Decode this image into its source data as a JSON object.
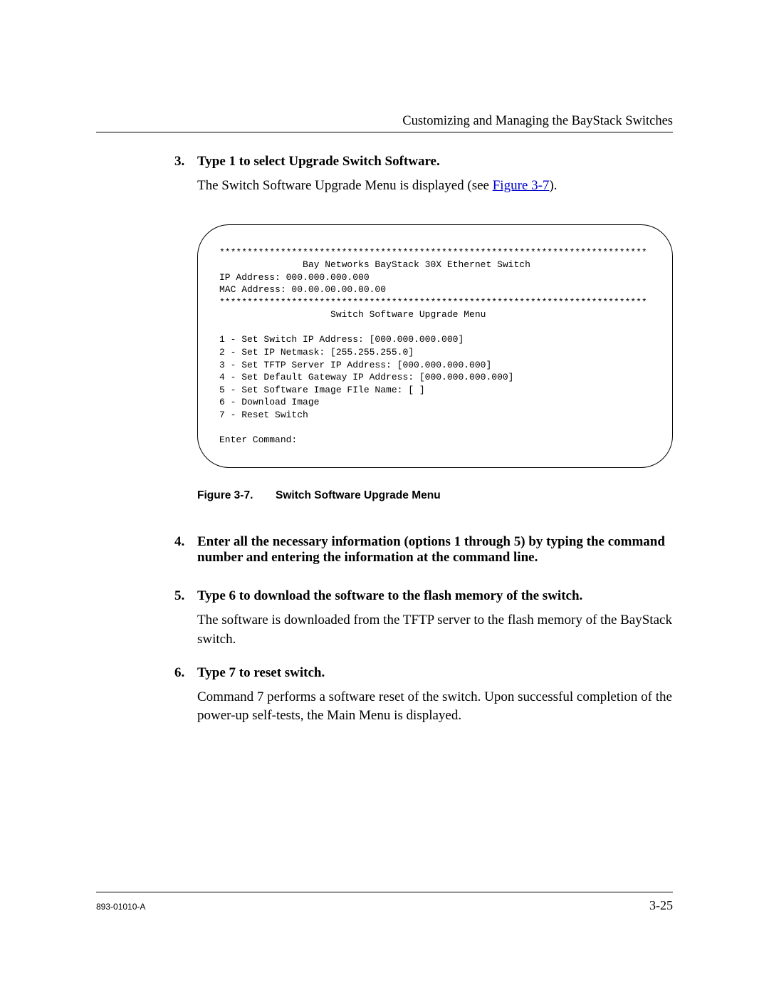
{
  "header": {
    "chapter_title": "Customizing and Managing the BayStack Switches"
  },
  "steps": [
    {
      "num": "3.",
      "title": "Type 1 to select Upgrade Switch Software.",
      "body_prefix": "The Switch Software Upgrade Menu is displayed (see ",
      "link_text": "Figure 3-7",
      "body_suffix": ")."
    },
    {
      "num": "4.",
      "title": "Enter all the necessary information (options 1 through 5) by typing the command number and entering the information at the command line."
    },
    {
      "num": "5.",
      "title": "Type 6 to download the software to the flash memory of the switch.",
      "body": "The software is downloaded from the TFTP server to the flash memory of the BayStack switch."
    },
    {
      "num": "6.",
      "title": "Type 7 to reset switch.",
      "body": "Command 7 performs a software reset of the switch. Upon successful completion of the power-up self-tests, the Main Menu is displayed."
    }
  ],
  "terminal": {
    "stars1": "*****************************************************************************",
    "device": "               Bay Networks BayStack 30X Ethernet Switch",
    "ip_line": "IP Address: 000.000.000.000",
    "mac_line": "MAC Address: 00.00.00.00.00.00",
    "stars2": "*****************************************************************************",
    "menu_title": "                    Switch Software Upgrade Menu",
    "items": [
      "1 - Set Switch IP Address: [000.000.000.000]",
      "2 - Set IP Netmask: [255.255.255.0]",
      "3 - Set TFTP Server IP Address: [000.000.000.000]",
      "4 - Set Default Gateway IP Address: [000.000.000.000]",
      "5 - Set Software Image FIle Name: [ ]",
      "6 - Download Image",
      "7 - Reset Switch"
    ],
    "prompt": "Enter Command:"
  },
  "figure": {
    "label": "Figure 3-7.",
    "caption": "Switch Software Upgrade Menu"
  },
  "footer": {
    "left": "893-01010-A",
    "right": "3-25"
  }
}
